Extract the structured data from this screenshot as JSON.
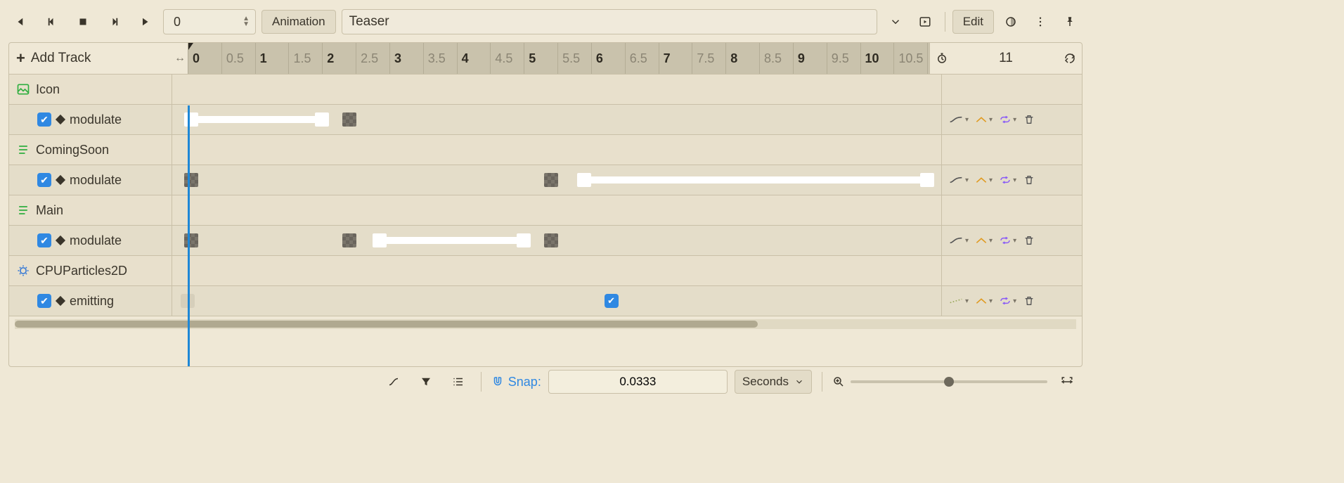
{
  "toolbar": {
    "frame_value": "0",
    "animation_label": "Animation",
    "animation_name": "Teaser",
    "edit_label": "Edit"
  },
  "header": {
    "add_track": "Add Track",
    "length": "11",
    "ruler": [
      "0",
      "0.5",
      "1",
      "1.5",
      "2",
      "2.5",
      "3",
      "3.5",
      "4",
      "4.5",
      "5",
      "5.5",
      "6",
      "6.5",
      "7",
      "7.5",
      "8",
      "8.5",
      "9",
      "9.5",
      "10",
      "10.5",
      "11",
      "1"
    ]
  },
  "tracks": [
    {
      "type": "node",
      "icon": "image",
      "name": "Icon"
    },
    {
      "type": "prop",
      "name": "modulate",
      "track_style": "color",
      "keys": [
        {
          "t": 0.05,
          "kind": "white"
        },
        {
          "t": 2.0,
          "kind": "white",
          "seg_from": 0.05
        },
        {
          "t": 2.4,
          "kind": "gray"
        }
      ]
    },
    {
      "type": "node",
      "icon": "text",
      "name": "ComingSoon"
    },
    {
      "type": "prop",
      "name": "modulate",
      "track_style": "color",
      "keys": [
        {
          "t": 0.05,
          "kind": "gray"
        },
        {
          "t": 5.4,
          "kind": "gray"
        },
        {
          "t": 5.9,
          "kind": "white",
          "seg_to": 11.0
        },
        {
          "t": 11.0,
          "kind": "white"
        }
      ]
    },
    {
      "type": "node",
      "icon": "text",
      "name": "Main"
    },
    {
      "type": "prop",
      "name": "modulate",
      "track_style": "color",
      "keys": [
        {
          "t": 0.05,
          "kind": "gray"
        },
        {
          "t": 2.4,
          "kind": "gray"
        },
        {
          "t": 2.85,
          "kind": "white",
          "seg_to": 5.0
        },
        {
          "t": 5.0,
          "kind": "white"
        },
        {
          "t": 5.4,
          "kind": "gray"
        }
      ]
    },
    {
      "type": "node",
      "icon": "particles",
      "name": "CPUParticles2D"
    },
    {
      "type": "prop",
      "name": "emitting",
      "track_style": "bool",
      "keys": [
        {
          "t": 0.0,
          "kind": "light"
        },
        {
          "t": 6.3,
          "kind": "bluecheck"
        }
      ]
    }
  ],
  "bottom": {
    "snap_label": "Snap:",
    "snap_value": "0.0333",
    "unit_label": "Seconds"
  }
}
